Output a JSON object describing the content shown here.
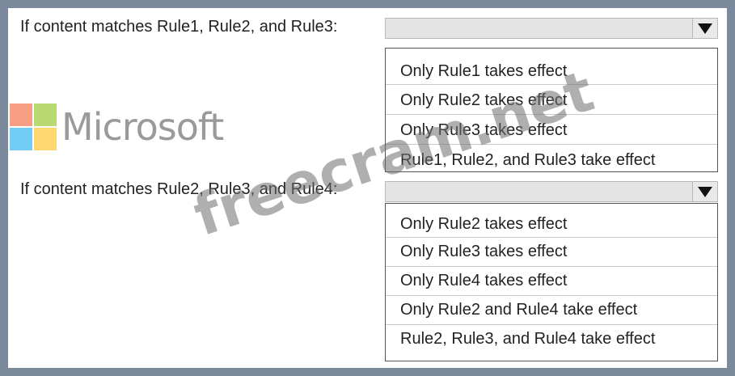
{
  "question1": {
    "label": "If content matches Rule1, Rule2, and Rule3:",
    "selected": "",
    "options": [
      "Only Rule1 takes effect",
      "Only Rule2 takes effect",
      "Only Rule3 takes effect",
      "Rule1, Rule2, and Rule3 take effect"
    ]
  },
  "question2": {
    "label": "If content matches Rule2, Rule3, and Rule4:",
    "selected": "",
    "options": [
      "Only Rule2 takes effect",
      "Only Rule3 takes effect",
      "Only Rule4 takes effect",
      "Only Rule2 and Rule4 take effect",
      "Rule2, Rule3, and Rule4 take effect"
    ]
  },
  "watermarks": {
    "logo_text": "Microsoft",
    "site_text": "freecram.net"
  },
  "icons": {
    "dropdown": "triangle-down-icon",
    "logo": "microsoft-logo-icon"
  },
  "colors": {
    "frame": "#7a8a9c",
    "select_bg": "#e4e4e4"
  }
}
